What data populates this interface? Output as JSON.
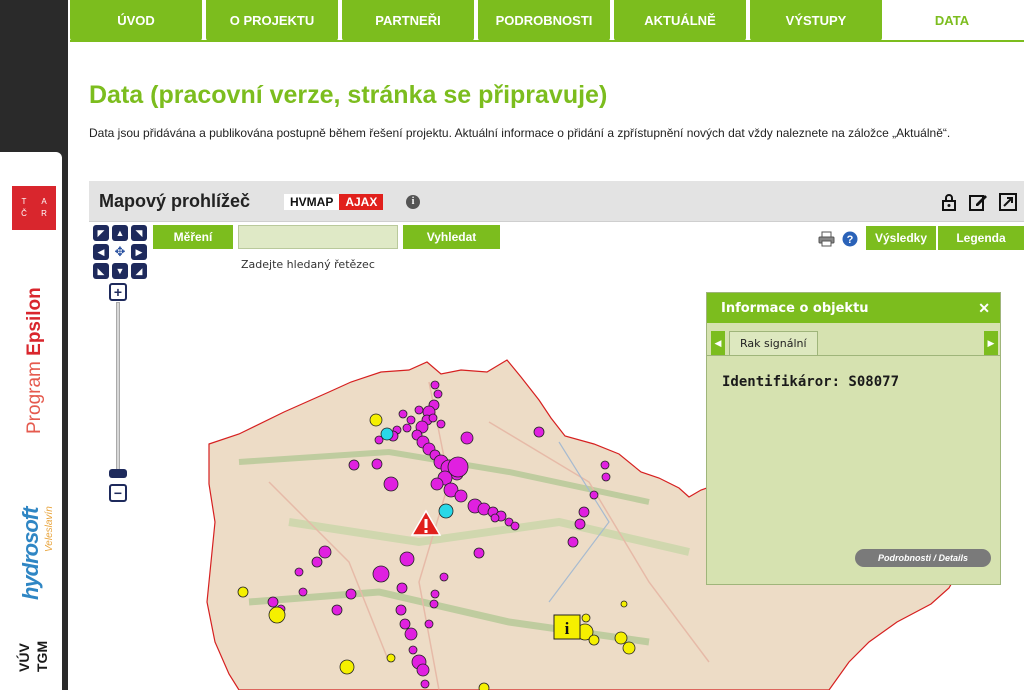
{
  "nav_tabs": [
    "ÚVOD",
    "O PROJEKTU",
    "PARTNEŘI",
    "PODROBNOSTI",
    "AKTUÁLNĚ",
    "VÝSTUPY",
    "DATA"
  ],
  "active_tab": "DATA",
  "sponsors": {
    "tacr_letters": [
      "T",
      "A",
      "Č",
      "R"
    ],
    "program": "Program",
    "program_name": "Epsilon",
    "hydrosoft": "hydrosoft",
    "hydrosoft_sub": "Veleslavín",
    "vuv_top": "VÚV",
    "vuv_bottom": "TGM"
  },
  "page": {
    "title": "Data (pracovní verze, stránka se připravuje)",
    "intro": "Data jsou přidávána a publikována postupně během řešení projektu. Aktuální informace o přidání a zpřístupnění nových dat vždy naleznete na záložce „Aktuálně“."
  },
  "viewer": {
    "title": "Mapový prohlížeč",
    "badge_left": "HVMAP",
    "badge_right": "AJAX",
    "info_glyph": "i",
    "measure_label": "Měření",
    "search_value": "",
    "search_label": "Vyhledat",
    "search_hint": "Zadejte hledaný řetězec",
    "results_label": "Výsledky",
    "legend_label": "Legenda",
    "icons": [
      "lock-icon",
      "edit-icon",
      "fullscreen-icon",
      "print-icon",
      "help-icon"
    ]
  },
  "info_panel": {
    "title": "Informace o objektu",
    "tab": "Rak signální",
    "identifier": "Identifikáror: S08077",
    "details": "Podrobnosti / Details"
  },
  "colors": {
    "accent_green": "#7cbd1e",
    "magenta_points": "#e020e0",
    "yellow_points": "#f5f000",
    "cyan_points": "#28d8e8",
    "border_red": "#d62020"
  }
}
